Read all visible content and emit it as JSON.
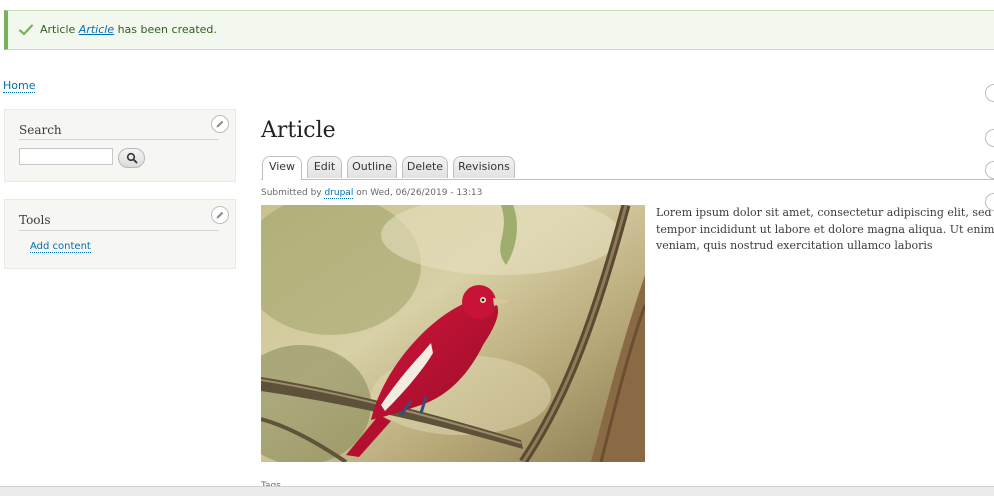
{
  "status_message": {
    "prefix": "Article ",
    "link": "Article",
    "suffix": " has been created.",
    "icon": "check-icon",
    "color": "#77b259"
  },
  "breadcrumb": {
    "home": "Home"
  },
  "sidebar": {
    "search_block": {
      "title": "Search",
      "input_value": "",
      "button_icon": "search-icon"
    },
    "tools_block": {
      "title": "Tools",
      "link": "Add content"
    }
  },
  "main": {
    "title": "Article",
    "tabs": [
      {
        "label": "View",
        "active": true
      },
      {
        "label": "Edit",
        "active": false
      },
      {
        "label": "Outline",
        "active": false
      },
      {
        "label": "Delete",
        "active": false
      },
      {
        "label": "Revisions",
        "active": false
      }
    ],
    "submitted": {
      "prefix": "Submitted by ",
      "author": "drupal",
      "suffix": " on Wed, 06/26/2019 - 13:13"
    },
    "image": {
      "subject": "red-bird-on-branch"
    },
    "body": [
      "Lorem ipsum dolor sit amet, consectetur adipiscing elit, sed do eiusmod",
      "tempor incididunt ut labore et dolore magna aliqua. Ut enim ad minim",
      "veniam, quis nostrud exercitation ullamco laboris"
    ],
    "tags_label": "Tags"
  },
  "colors": {
    "link": "#0071b3",
    "status_bg": "#f3f8ef",
    "block_bg": "#f6f6f2"
  }
}
